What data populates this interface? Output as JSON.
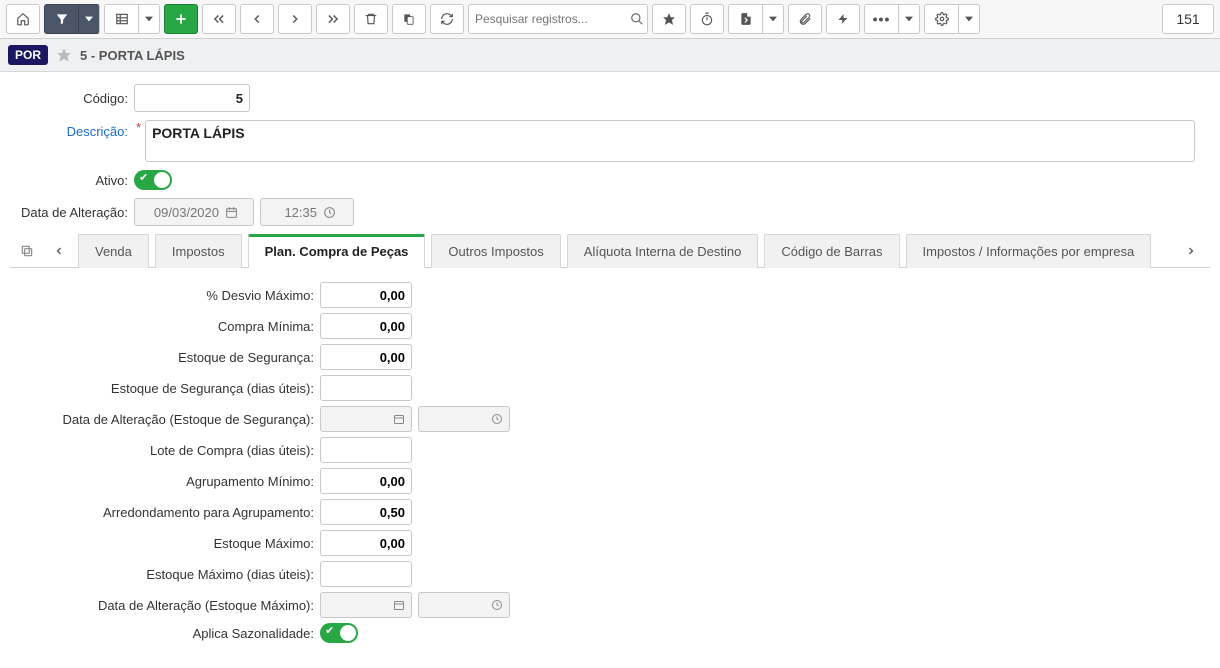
{
  "toolbar": {
    "search_placeholder": "Pesquisar registros...",
    "count": "151"
  },
  "header": {
    "badge": "POR",
    "title": "5 - PORTA LÁPIS"
  },
  "form": {
    "codigo_label": "Código:",
    "codigo_value": "5",
    "descricao_label": "Descrição:",
    "descricao_value": "PORTA LÁPIS",
    "ativo_label": "Ativo:",
    "data_alteracao_label": "Data de Alteração:",
    "data_alteracao_date": "09/03/2020",
    "data_alteracao_time": "12:35"
  },
  "tabs": {
    "venda": "Venda",
    "impostos": "Impostos",
    "plan_compra": "Plan. Compra de Peças",
    "outros_impostos": "Outros Impostos",
    "aliquota": "Alíquota Interna de Destino",
    "codigo_barras": "Código de Barras",
    "impostos_empresa": "Impostos / Informações por empresa"
  },
  "plan": {
    "desvio_max_label": "% Desvio Máximo:",
    "desvio_max_value": "0,00",
    "compra_min_label": "Compra Mínima:",
    "compra_min_value": "0,00",
    "est_seg_label": "Estoque de Segurança:",
    "est_seg_value": "0,00",
    "est_seg_dias_label": "Estoque de Segurança (dias úteis):",
    "est_seg_dias_value": "",
    "data_alt_est_seg_label": "Data de Alteração (Estoque de Segurança):",
    "lote_compra_label": "Lote de Compra (dias úteis):",
    "lote_compra_value": "",
    "agrup_min_label": "Agrupamento Mínimo:",
    "agrup_min_value": "0,00",
    "arred_agrup_label": "Arredondamento para Agrupamento:",
    "arred_agrup_value": "0,50",
    "est_max_label": "Estoque Máximo:",
    "est_max_value": "0,00",
    "est_max_dias_label": "Estoque Máximo (dias úteis):",
    "est_max_dias_value": "",
    "data_alt_est_max_label": "Data de Alteração (Estoque Máximo):",
    "sazonalidade_label": "Aplica Sazonalidade:"
  }
}
